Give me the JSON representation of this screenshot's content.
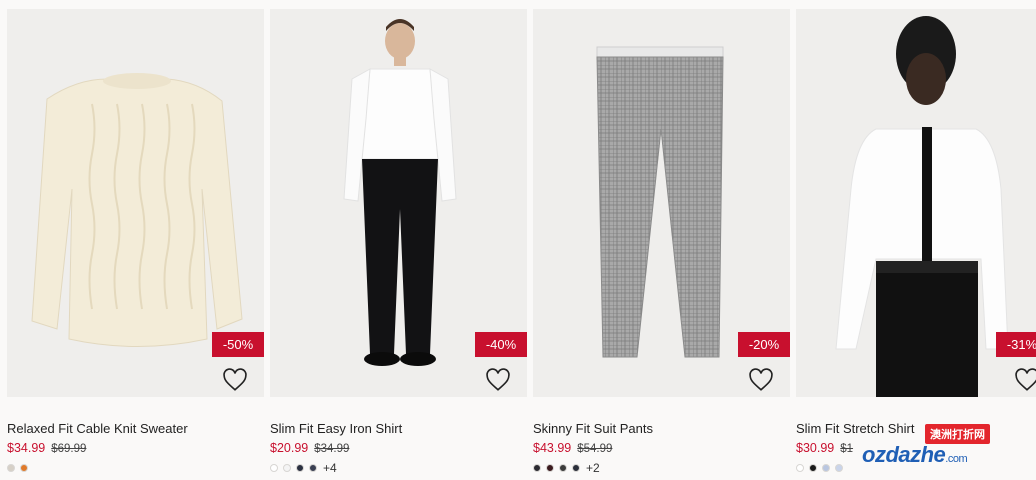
{
  "products": [
    {
      "title": "Relaxed Fit Cable Knit Sweater",
      "price": "$34.99",
      "old_price": "$69.99",
      "discount": "-50%",
      "swatches": [
        "#d6d0c7",
        "#e07a2a"
      ],
      "more": ""
    },
    {
      "title": "Slim Fit Easy Iron Shirt",
      "price": "$20.99",
      "old_price": "$34.99",
      "discount": "-40%",
      "swatches": [
        "#ffffff",
        "#f4f4f4",
        "#2b3040",
        "#3a3f52"
      ],
      "more": "+4"
    },
    {
      "title": "Skinny Fit Suit Pants",
      "price": "$43.99",
      "old_price": "$54.99",
      "discount": "-20%",
      "swatches": [
        "#2a2a30",
        "#3a1a1e",
        "#3b3b3b",
        "#2b2f3a"
      ],
      "more": "+2"
    },
    {
      "title": "Slim Fit Stretch Shirt",
      "price": "$30.99",
      "old_price": "$1",
      "discount": "-31%",
      "swatches": [
        "#ffffff",
        "#1a1a1a",
        "#b9c6e0",
        "#c9d4ea"
      ],
      "more": ""
    }
  ],
  "watermark": {
    "cn": "澳洲打折网",
    "en": "ozdazhe",
    "suffix": ".com"
  },
  "icons": {
    "favorite": "heart-outline-icon"
  }
}
